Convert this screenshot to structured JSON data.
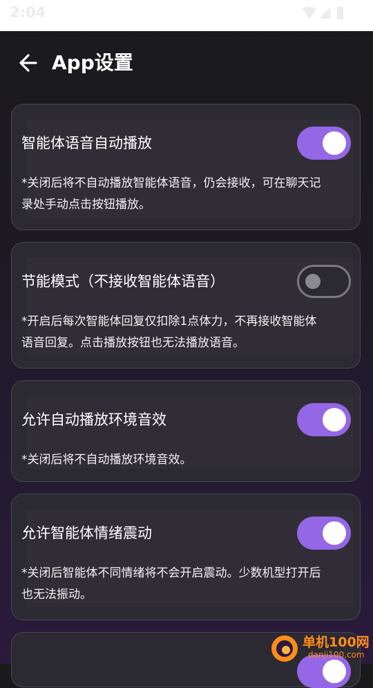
{
  "status_bar": {
    "time": "2:04",
    "icons": [
      "wifi-icon",
      "signal-icon",
      "battery-icon"
    ]
  },
  "header": {
    "back_icon": "arrow-left-icon",
    "title": "App设置"
  },
  "settings": [
    {
      "label": "智能体语音自动播放",
      "toggle_on": true,
      "desc_lines": [
        "*关闭后将不自动播放智能体语音，仍会接收，可在聊天记",
        "录处手动点击按钮播放。"
      ]
    },
    {
      "label": "节能模式（不接收智能体语音）",
      "toggle_on": false,
      "desc_lines": [
        "*开启后每次智能体回复仅扣除1点体力，不再接收智能体",
        "语音回复。点击播放按钮也无法播放语音。"
      ]
    },
    {
      "label": "允许自动播放环境音效",
      "toggle_on": true,
      "desc_lines": [
        "*关闭后将不自动播放环境音效。"
      ]
    },
    {
      "label": "允许智能体情绪震动",
      "toggle_on": true,
      "desc_lines": [
        "*关闭后智能体不同情绪将不会开启震动。少数机型打开后",
        "也无法振动。"
      ]
    }
  ],
  "watermark": {
    "cn": "单机100网",
    "en": "danji100.com"
  },
  "colors": {
    "accent_toggle": "#9467e6",
    "card_bg": "#2b2931",
    "card_border": "#4a4752",
    "watermark": "#ff8c1a"
  }
}
